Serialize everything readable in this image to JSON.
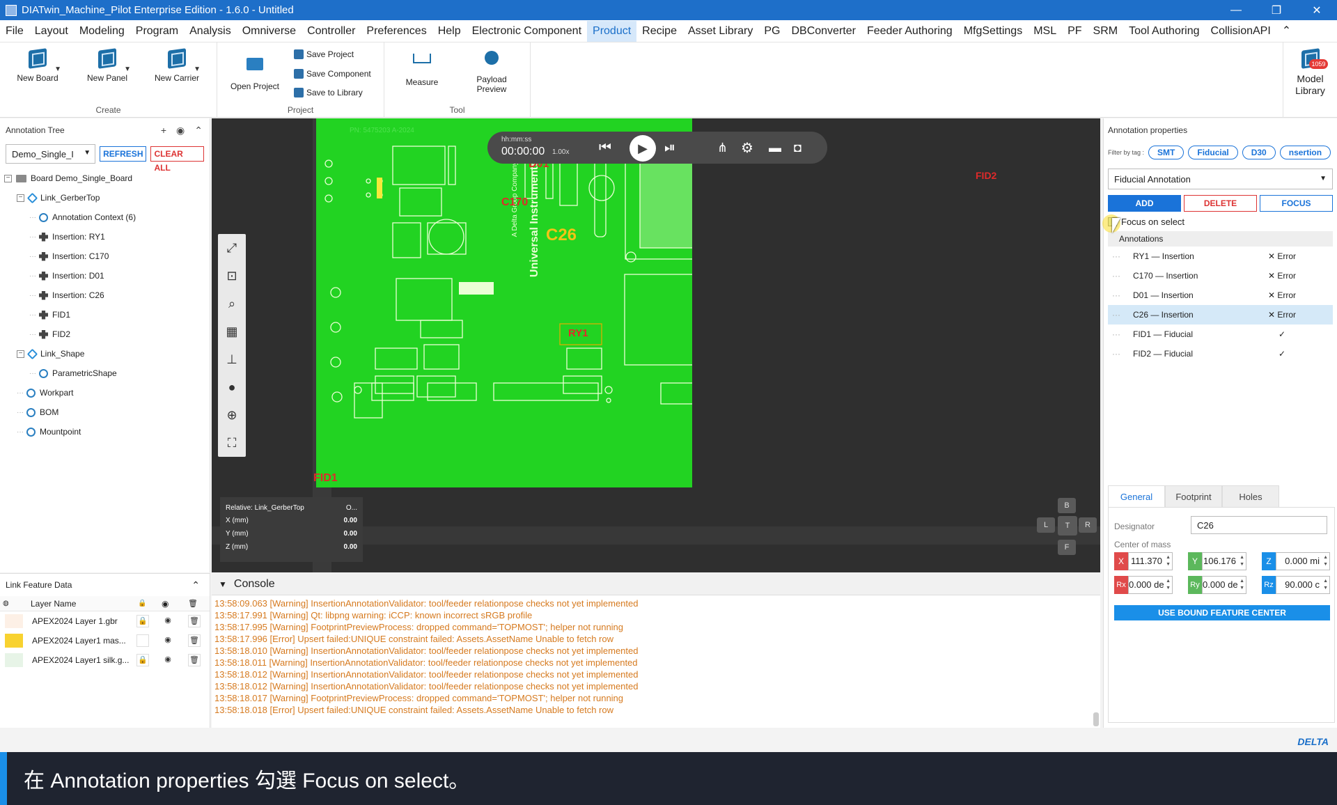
{
  "window": {
    "title": "DIATwin_Machine_Pilot Enterprise Edition - 1.6.0 - Untitled",
    "minimize": "—",
    "restore": "❐",
    "close": "✕"
  },
  "menu": [
    "File",
    "Layout",
    "Modeling",
    "Program",
    "Analysis",
    "Omniverse",
    "Controller",
    "Preferences",
    "Help",
    "Electronic Component",
    "Product",
    "Recipe",
    "Asset Library",
    "PG",
    "DBConverter",
    "Feeder Authoring",
    "MfgSettings",
    "MSL",
    "PF",
    "SRM",
    "Tool Authoring",
    "CollisionAPI"
  ],
  "menu_active": "Product",
  "menu_collapse": "⌃",
  "ribbon": {
    "create_group": "Create",
    "project_group": "Project",
    "tool_group": "Tool",
    "new_board": "New Board",
    "new_panel": "New Panel",
    "new_carrier": "New Carrier",
    "open_project": "Open Project",
    "save_project": "Save Project",
    "save_component": "Save Component",
    "save_to_library": "Save to Library",
    "measure": "Measure",
    "payload_preview": "Payload Preview",
    "model_library": "Model Library",
    "model_library_badge": "1059"
  },
  "annotation_tree": {
    "title": "Annotation Tree",
    "board_select": "Demo_Single_I",
    "refresh": "REFRESH",
    "clear_all": "CLEAR ALL",
    "nodes": [
      {
        "label": "Board  Demo_Single_Board",
        "level": 0,
        "icon": "folder-icon",
        "exp": "⊟"
      },
      {
        "label": "Link_GerberTop",
        "level": 1,
        "icon": "link-icon",
        "exp": "⊟"
      },
      {
        "label": "Annotation Context (6)",
        "level": 2,
        "icon": "context-icon",
        "exp": ""
      },
      {
        "label": "Insertion: RY1",
        "level": 2,
        "icon": "insertion-icon",
        "exp": ""
      },
      {
        "label": "Insertion: C170",
        "level": 2,
        "icon": "insertion-icon",
        "exp": ""
      },
      {
        "label": "Insertion: D01",
        "level": 2,
        "icon": "insertion-icon",
        "exp": ""
      },
      {
        "label": "Insertion: C26",
        "level": 2,
        "icon": "insertion-icon",
        "exp": ""
      },
      {
        "label": "FID1",
        "level": 2,
        "icon": "insertion-icon",
        "exp": ""
      },
      {
        "label": "FID2",
        "level": 2,
        "icon": "insertion-icon",
        "exp": ""
      },
      {
        "label": "Link_Shape",
        "level": 1,
        "icon": "link-icon",
        "exp": "⊟"
      },
      {
        "label": "ParametricShape",
        "level": 2,
        "icon": "context-icon",
        "exp": ""
      },
      {
        "label": "Workpart",
        "level": 1,
        "icon": "context-icon",
        "exp": ""
      },
      {
        "label": "BOM",
        "level": 1,
        "icon": "context-icon",
        "exp": ""
      },
      {
        "label": "Mountpoint",
        "level": 1,
        "icon": "context-icon",
        "exp": ""
      }
    ]
  },
  "link_feature": {
    "title": "Link Feature Data",
    "col_layer": "Layer Name",
    "rows": [
      {
        "name": "APEX2024 Layer 1.gbr",
        "color": "#fdf0e6",
        "lock": "🔒",
        "lockshow": true
      },
      {
        "name": "APEX2024 Layer1 mas...",
        "color": "#f8d230",
        "lock": "",
        "lockshow": false
      },
      {
        "name": "APEX2024 Layer1 silk.g...",
        "color": "#e7f4e7",
        "lock": "🔒",
        "lockshow": true
      }
    ]
  },
  "viewport": {
    "time_label": "hh:mm:ss",
    "time": "00:00:00",
    "speed": "1.00x",
    "pcb_labels": {
      "d01": "D01",
      "c170": "C170",
      "c26": "C26",
      "ry1": "RY1",
      "fid1": "FID1",
      "fid2": "FID2",
      "pn": "PN: 5475203   A-2024",
      "brand": "Universal Instruments",
      "brand2": "A Delta Group Company"
    },
    "readout": {
      "relative": "Relative: Link_GerberTop",
      "extra": "O...",
      "x_label": "X (mm)",
      "y_label": "Y (mm)",
      "z_label": "Z (mm)",
      "x": "0.00",
      "y": "0.00",
      "z": "0.00"
    },
    "navcube": {
      "b": "B",
      "l": "L",
      "t": "T",
      "r": "R",
      "f": "F"
    }
  },
  "annotation_properties": {
    "title": "Annotation properties",
    "filter_label": "Filter by tag :",
    "tags": [
      "SMT",
      "Fiducial",
      "D30",
      "nsertion"
    ],
    "type_select": "Fiducial Annotation",
    "add": "ADD",
    "delete": "DELETE",
    "focus": "FOCUS",
    "focus_on_select": "Focus on select",
    "annotations_header": "Annotations",
    "annotations": [
      {
        "name": "RY1 — Insertion",
        "status": "✕ Error"
      },
      {
        "name": "C170 — Insertion",
        "status": "✕ Error"
      },
      {
        "name": "D01 — Insertion",
        "status": "✕ Error"
      },
      {
        "name": "C26 — Insertion",
        "status": "✕ Error"
      },
      {
        "name": "FID1 — Fiducial",
        "status": "✓"
      },
      {
        "name": "FID2 — Fiducial",
        "status": "✓"
      }
    ],
    "selected_index": 3,
    "tabs": [
      "General",
      "Footprint",
      "Holes"
    ],
    "designator_label": "Designator",
    "designator": "C26",
    "center_label": "Center of mass",
    "x": "111.370",
    "y": "106.176",
    "z": "0.000 mi",
    "rx": "0.000 de",
    "ry": "0.000 de",
    "rz": "90.000 c",
    "use_bound": "USE BOUND FEATURE CENTER",
    "axis_colors": {
      "x": "#e04a4a",
      "y": "#5cb85c",
      "z": "#1a8fe8"
    }
  },
  "console": {
    "title": "Console",
    "lines": [
      "13:58:09.063 [Warning] InsertionAnnotationValidator: tool/feeder relationpose checks not yet implemented",
      "13:58:17.991 [Warning] Qt: libpng warning: iCCP: known incorrect sRGB profile",
      "13:58:17.995 [Warning] FootprintPreviewProcess: dropped command='TOPMOST'; helper not running",
      "13:58:17.996 [Error] Upsert failed:UNIQUE constraint failed: Assets.AssetName Unable to fetch row",
      "13:58:18.010 [Warning] InsertionAnnotationValidator: tool/feeder relationpose checks not yet implemented",
      "13:58:18.011 [Warning] InsertionAnnotationValidator: tool/feeder relationpose checks not yet implemented",
      "13:58:18.012 [Warning] InsertionAnnotationValidator: tool/feeder relationpose checks not yet implemented",
      "13:58:18.012 [Warning] InsertionAnnotationValidator: tool/feeder relationpose checks not yet implemented",
      "13:58:18.017 [Warning] FootprintPreviewProcess: dropped command='TOPMOST'; helper not running",
      "13:58:18.018 [Error] Upsert failed:UNIQUE constraint failed: Assets.AssetName Unable to fetch row"
    ]
  },
  "brand": "DELTA",
  "caption": "在 Annotation properties 勾選 Focus on select。",
  "colors": {
    "accent": "#1a73d9",
    "titlebar": "#1e6fc9",
    "pcb": "#22d322",
    "console": "#d67a1f"
  }
}
